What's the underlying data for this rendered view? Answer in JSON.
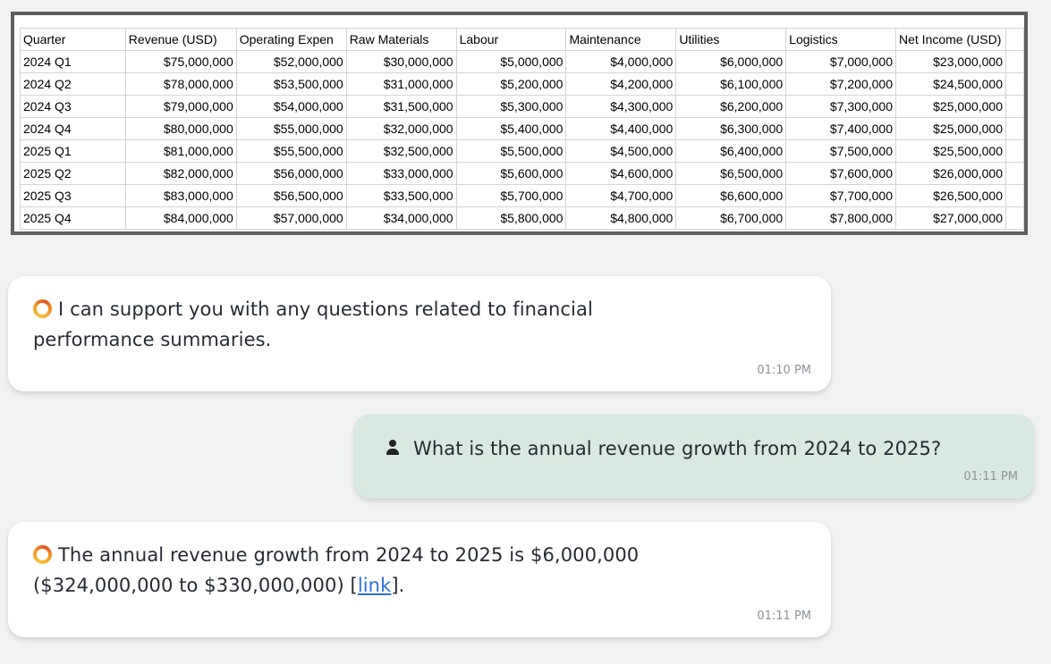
{
  "sheet": {
    "columns": [
      "Quarter",
      "Revenue (USD)",
      "Operating Expen",
      "Raw Materials",
      "Labour",
      "Maintenance",
      "Utilities",
      "Logistics",
      "Net Income (USD)"
    ],
    "rows": [
      [
        "2024 Q1",
        "$75,000,000",
        "$52,000,000",
        "$30,000,000",
        "$5,000,000",
        "$4,000,000",
        "$6,000,000",
        "$7,000,000",
        "$23,000,000"
      ],
      [
        "2024 Q2",
        "$78,000,000",
        "$53,500,000",
        "$31,000,000",
        "$5,200,000",
        "$4,200,000",
        "$6,100,000",
        "$7,200,000",
        "$24,500,000"
      ],
      [
        "2024 Q3",
        "$79,000,000",
        "$54,000,000",
        "$31,500,000",
        "$5,300,000",
        "$4,300,000",
        "$6,200,000",
        "$7,300,000",
        "$25,000,000"
      ],
      [
        "2024 Q4",
        "$80,000,000",
        "$55,000,000",
        "$32,000,000",
        "$5,400,000",
        "$4,400,000",
        "$6,300,000",
        "$7,400,000",
        "$25,000,000"
      ],
      [
        "2025 Q1",
        "$81,000,000",
        "$55,500,000",
        "$32,500,000",
        "$5,500,000",
        "$4,500,000",
        "$6,400,000",
        "$7,500,000",
        "$25,500,000"
      ],
      [
        "2025 Q2",
        "$82,000,000",
        "$56,000,000",
        "$33,000,000",
        "$5,600,000",
        "$4,600,000",
        "$6,500,000",
        "$7,600,000",
        "$26,000,000"
      ],
      [
        "2025 Q3",
        "$83,000,000",
        "$56,500,000",
        "$33,500,000",
        "$5,700,000",
        "$4,700,000",
        "$6,600,000",
        "$7,700,000",
        "$26,500,000"
      ],
      [
        "2025 Q4",
        "$84,000,000",
        "$57,000,000",
        "$34,000,000",
        "$5,800,000",
        "$4,800,000",
        "$6,700,000",
        "$7,800,000",
        "$27,000,000"
      ]
    ]
  },
  "chat": {
    "bot_icon": "ring-logo-icon",
    "user_icon": "person-icon",
    "msg1": {
      "line1": "I can support you with any questions related to financial",
      "line2": "performance summaries.",
      "time": "01:10 PM"
    },
    "msg2": {
      "text": "What is the annual revenue growth from 2024 to 2025?",
      "time": "01:11 PM"
    },
    "msg3": {
      "line1": "The annual revenue growth from 2024 to 2025 is $6,000,000",
      "line2_pre": "($324,000,000 to $330,000,000) [",
      "link": "link",
      "line2_post": "].",
      "time": "01:11 PM"
    }
  }
}
